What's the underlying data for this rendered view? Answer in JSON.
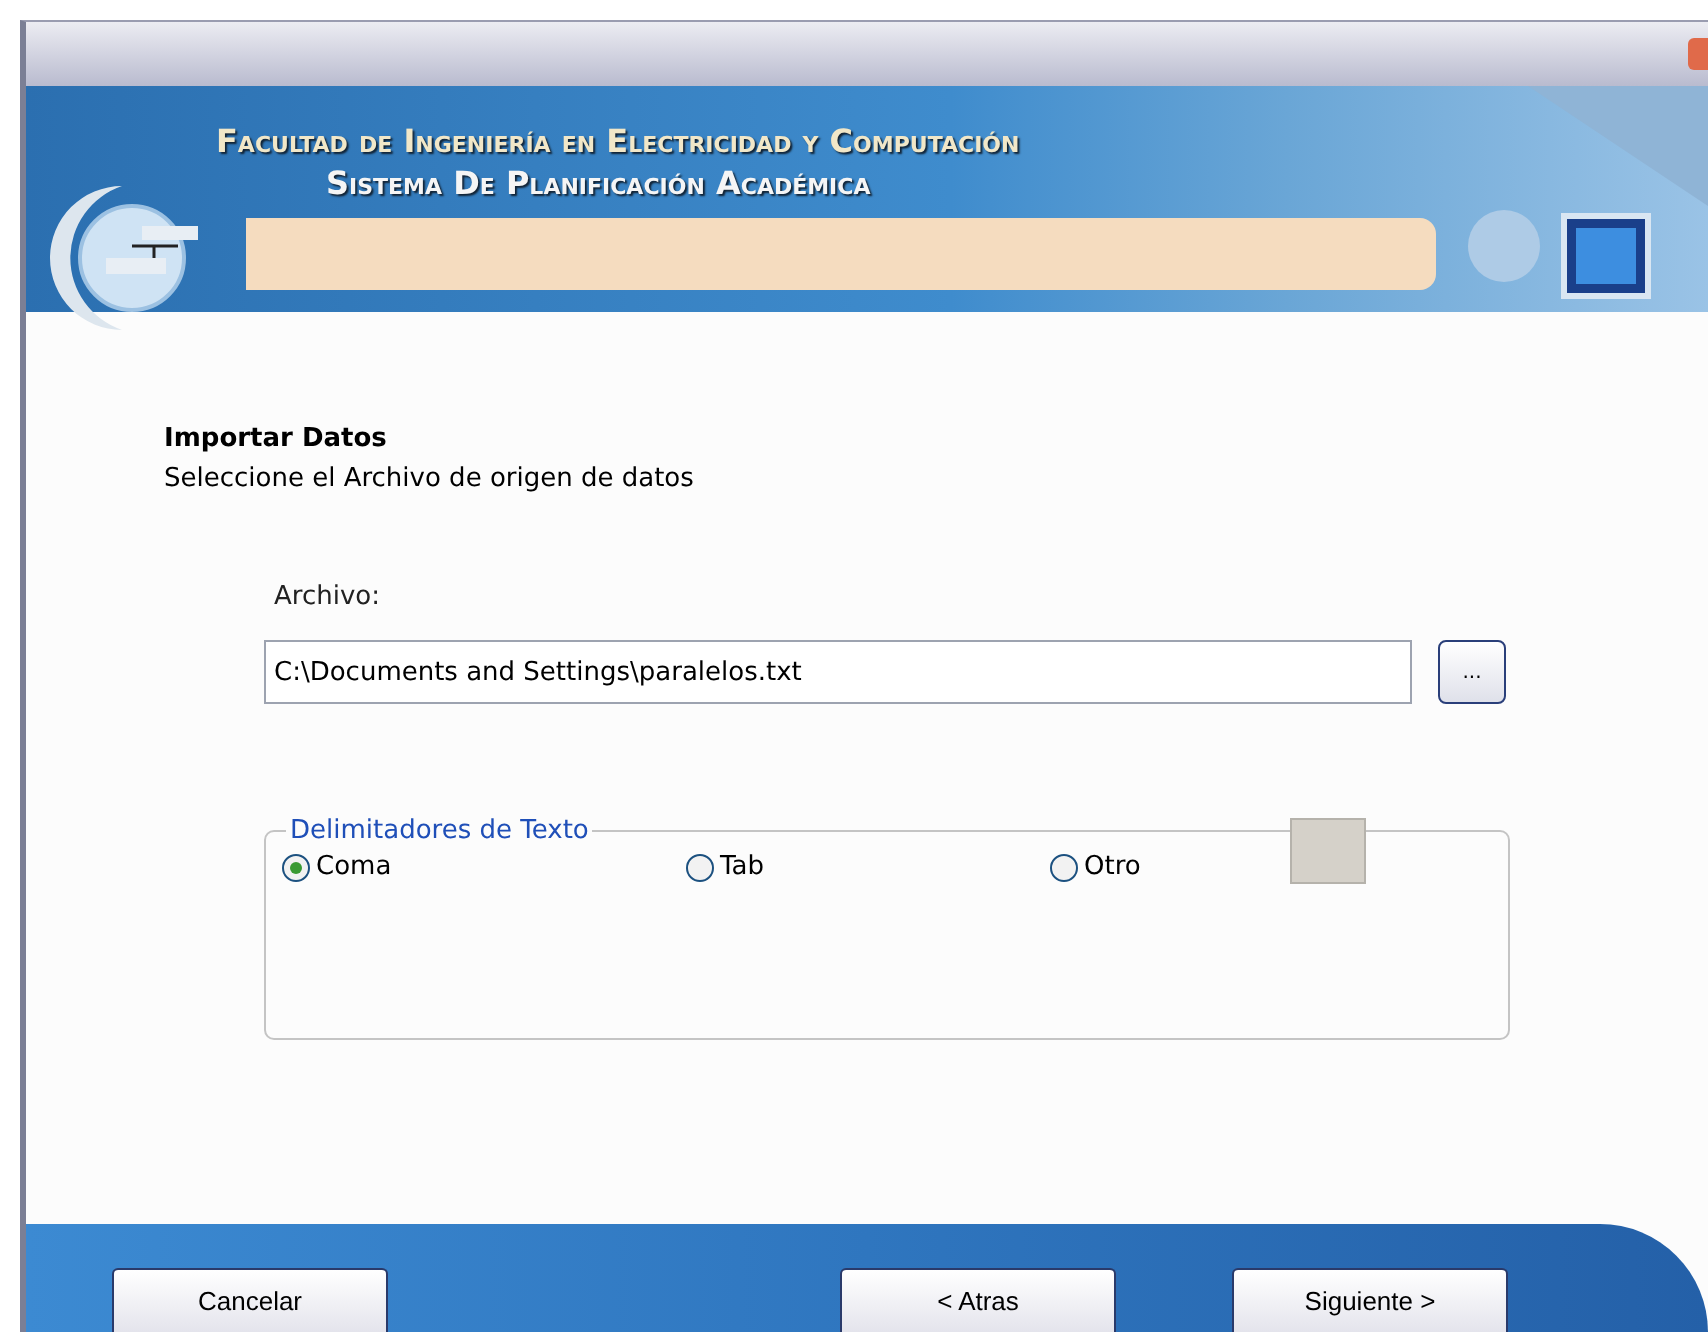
{
  "banner": {
    "title": "Facultad de Ingeniería en Electricidad y Computación",
    "subtitle": "Sistema De Planificación Académica"
  },
  "heading": "Importar Datos",
  "instruction": "Seleccione el Archivo de origen de datos",
  "file": {
    "label": "Archivo:",
    "value": "C:\\Documents and Settings\\paralelos.txt",
    "browse": "..."
  },
  "delimiters": {
    "legend": "Delimitadores de Texto",
    "options": [
      {
        "label": "Coma",
        "selected": true
      },
      {
        "label": "Tab",
        "selected": false
      },
      {
        "label": "Otro",
        "selected": false
      }
    ]
  },
  "buttons": [
    {
      "label": "Cancelar",
      "kind": "left"
    },
    {
      "label": "< Atras",
      "kind": "right"
    },
    {
      "label": "Siguiente >",
      "kind": "right"
    }
  ]
}
